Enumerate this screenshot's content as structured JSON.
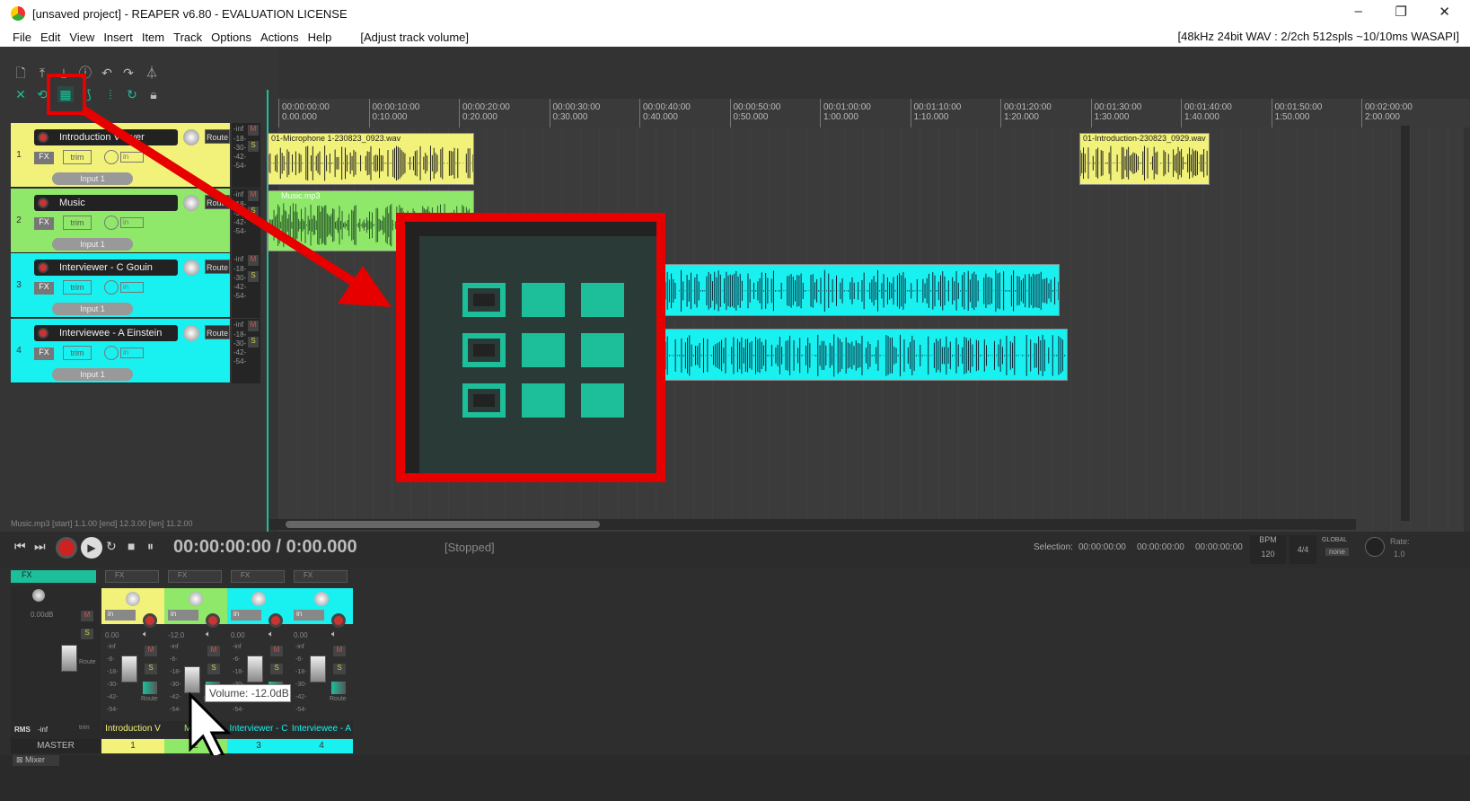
{
  "window": {
    "title": "[unsaved project] - REAPER v6.80 - EVALUATION LICENSE",
    "min": "–",
    "max": "❐",
    "close": "✕"
  },
  "menu": {
    "items": [
      "File",
      "Edit",
      "View",
      "Insert",
      "Item",
      "Track",
      "Options",
      "Actions",
      "Help"
    ],
    "hint": "[Adjust track volume]",
    "device": "[48kHz 24bit WAV : 2/2ch 512spls ~10/10ms WASAPI]"
  },
  "ruler": {
    "labels": [
      {
        "t": "00:00:00:00",
        "b": "0.00.000"
      },
      {
        "t": "00:00:10:00",
        "b": "0:10.000"
      },
      {
        "t": "00:00:20:00",
        "b": "0:20.000"
      },
      {
        "t": "00:00:30:00",
        "b": "0:30.000"
      },
      {
        "t": "00:00:40:00",
        "b": "0:40.000"
      },
      {
        "t": "00:00:50:00",
        "b": "0:50.000"
      },
      {
        "t": "00:01:00:00",
        "b": "1:00.000"
      },
      {
        "t": "00:01:10:00",
        "b": "1:10.000"
      },
      {
        "t": "00:01:20:00",
        "b": "1:20.000"
      },
      {
        "t": "00:01:30:00",
        "b": "1:30.000"
      },
      {
        "t": "00:01:40:00",
        "b": "1:40.000"
      },
      {
        "t": "00:01:50:00",
        "b": "1:50.000"
      },
      {
        "t": "00:02:00:00",
        "b": "2:00.000"
      }
    ]
  },
  "tracks": [
    {
      "num": "1",
      "name": "Introduction V Over",
      "color": "#f2f27a",
      "input": "Input 1",
      "fx": "FX",
      "trim": "trim",
      "route": "Route",
      "in": "in"
    },
    {
      "num": "2",
      "name": "Music",
      "color": "#8fe86a",
      "input": "Input 1",
      "fx": "FX",
      "trim": "trim",
      "route": "Route",
      "in": "in"
    },
    {
      "num": "3",
      "name": "Interviewer - C Gouin",
      "color": "#19f0f0",
      "input": "Input 1",
      "fx": "FX",
      "trim": "trim",
      "route": "Route",
      "in": "in"
    },
    {
      "num": "4",
      "name": "Interviewee - A Einstein",
      "color": "#19f0f0",
      "input": "Input 1",
      "fx": "FX",
      "trim": "trim",
      "route": "Route",
      "in": "in"
    }
  ],
  "meter": {
    "top": "-inf",
    "ticks": [
      "-18-",
      "-30-",
      "-42-",
      "-54-"
    ],
    "m": "M",
    "s": "S"
  },
  "items": {
    "mic1": "01-Microphone 1-230823_0923.wav",
    "music": "Music.mp3",
    "intro2": "01-Introduction-230823_0929.wav"
  },
  "status": {
    "itemInfo": "Music.mp3 [start] 1.1.00 [end] 12.3.00 [len] 11.2.00"
  },
  "transport": {
    "time": "00:00:00:00 / 0:00.000",
    "state": "[Stopped]",
    "selLabel": "Selection:",
    "sel1": "00:00:00:00",
    "sel2": "00:00:00:00",
    "sel3": "00:00:00:00",
    "bpmLabel": "BPM",
    "bpm": "120",
    "sig": "4/4",
    "global": "GLOBAL",
    "none": "none",
    "rate": "Rate:",
    "rateVal": "1.0"
  },
  "mixer": {
    "master": {
      "label": "MASTER",
      "vol": "0.00dB",
      "rms": "RMS",
      "inf": "-inf",
      "fx": "FX",
      "route": "Route",
      "trim": "trim",
      "m": "M",
      "s": "S"
    },
    "strips": [
      {
        "label": "Introduction V",
        "num": "1",
        "vol": "0.00",
        "color": "#f2f27a",
        "ticks": [
          "-inf",
          "-6-",
          "-18-",
          "-30-",
          "-42-",
          "-54-"
        ]
      },
      {
        "label": "Music",
        "num": "2",
        "vol": "-12.0",
        "color": "#8fe86a",
        "ticks": [
          "-inf",
          "-6-",
          "-18-",
          "-30-",
          "-42-",
          "-54-"
        ]
      },
      {
        "label": "Interviewer - C",
        "num": "3",
        "vol": "0.00",
        "color": "#19f0f0",
        "ticks": [
          "-inf",
          "-6-",
          "-18-",
          "-30-",
          "-42-",
          "-54-"
        ]
      },
      {
        "label": "Interviewee - A",
        "num": "4",
        "vol": "0.00",
        "color": "#19f0f0",
        "ticks": [
          "-inf",
          "-6-",
          "-18-",
          "-30-",
          "-42-",
          "-54-"
        ]
      }
    ],
    "stripFx": "FX",
    "stripIn": "in",
    "stripRoute": "Route",
    "tooltip": "Volume: -12.0dB",
    "tab": "Mixer"
  },
  "colors": {
    "highlight": "#e60000",
    "teal": "#1dbf9a"
  }
}
